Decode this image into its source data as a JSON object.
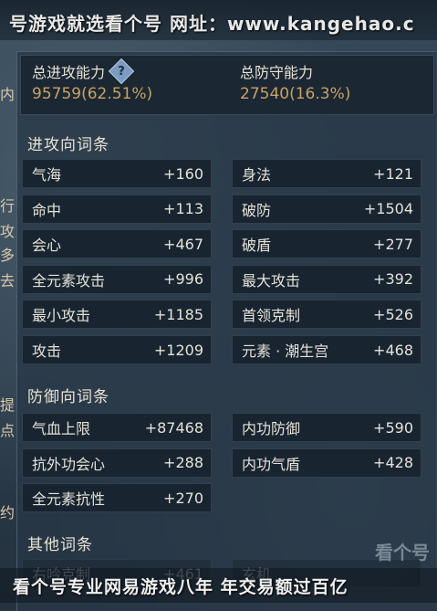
{
  "banner_top": "号游戏就选看个号 网址：www.kangehao.c",
  "side_fragments": [
    "内",
    "行",
    "攻",
    "多",
    "去",
    "提",
    "点",
    "约"
  ],
  "summary": {
    "attack_label": "总进攻能力",
    "attack_value": "95759(62.51%)",
    "defense_label": "总防守能力",
    "defense_value": "27540(16.3%)",
    "help_glyph": "?"
  },
  "sections": {
    "attack": "进攻向词条",
    "defense": "防御向词条",
    "other": "其他词条"
  },
  "attack_stats": [
    {
      "name": "气海",
      "value": "+160"
    },
    {
      "name": "身法",
      "value": "+121"
    },
    {
      "name": "命中",
      "value": "+113"
    },
    {
      "name": "破防",
      "value": "+1504"
    },
    {
      "name": "会心",
      "value": "+467"
    },
    {
      "name": "破盾",
      "value": "+277"
    },
    {
      "name": "全元素攻击",
      "value": "+996"
    },
    {
      "name": "最大攻击",
      "value": "+392"
    },
    {
      "name": "最小攻击",
      "value": "+1185"
    },
    {
      "name": "首领克制",
      "value": "+526"
    },
    {
      "name": "攻击",
      "value": "+1209"
    },
    {
      "name": "元素 · 潮生宫",
      "value": "+468"
    }
  ],
  "defense_stats": [
    {
      "name": "气血上限",
      "value": "+87468"
    },
    {
      "name": "内功防御",
      "value": "+590"
    },
    {
      "name": "抗外功会心",
      "value": "+288"
    },
    {
      "name": "内功气盾",
      "value": "+428"
    },
    {
      "name": "全元素抗性",
      "value": "+270"
    }
  ],
  "other_stats_partial": [
    {
      "name": "右吟克制",
      "value": "+461"
    },
    {
      "name": "玄机",
      "value": ""
    }
  ],
  "banner_bottom": "看个号专业网易游戏八年 年交易额过百亿",
  "watermark": "看个号",
  "colors": {
    "gold_value": "#c9a263",
    "label_text": "#e9e3d3",
    "cell_bg": "#16222e"
  }
}
